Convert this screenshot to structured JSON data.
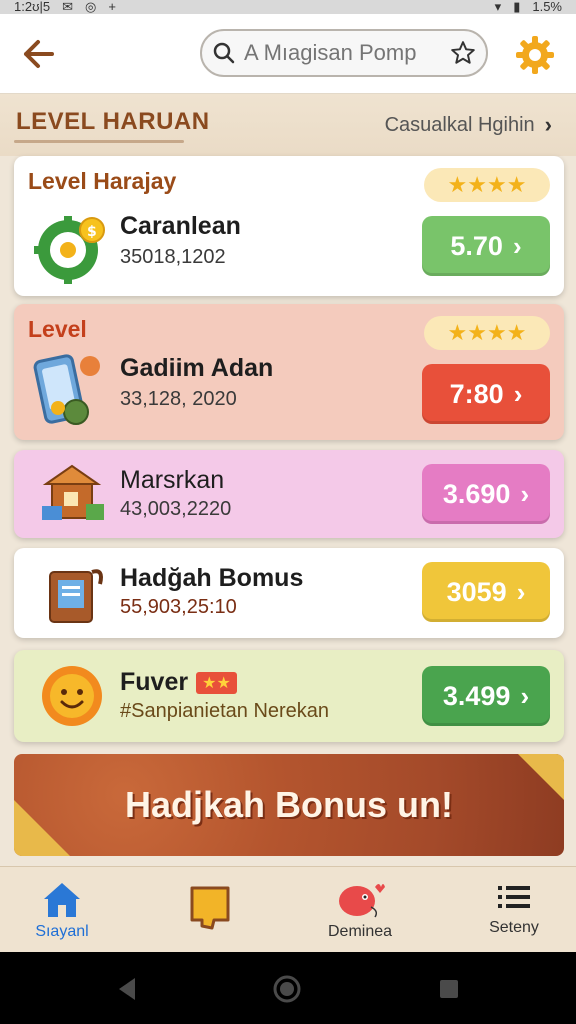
{
  "status_bar": {
    "time": "1:2ʊ|5",
    "battery": "1.5%"
  },
  "header": {
    "search_placeholder": "A Mıagisan Pomp"
  },
  "section": {
    "title": "LEVEL HARUAN",
    "link_label": "Casualkal Hgihin"
  },
  "cards": [
    {
      "tag": "Level Harajay",
      "name": "Caranlean",
      "meta": "35018,1202",
      "stars": "★★★★",
      "price": "5.70",
      "icon": "gear-coin-icon",
      "bg": "#ffffff",
      "tag_color": "#9a4b18",
      "btn_color": "#79c46a"
    },
    {
      "tag": "Level",
      "name": "Gadiim Adan",
      "meta": "33,128, 2020",
      "stars": "★★★★",
      "price": "7:80",
      "icon": "phone-gift-icon",
      "bg": "#f4cbbd",
      "tag_color": "#c4401c",
      "btn_color": "#e8503a"
    },
    {
      "name": "Marsrkan",
      "meta": "43,003,2220",
      "price": "3.690",
      "icon": "shop-icon",
      "bg": "#f4c9e8",
      "btn_color": "#e57cc4"
    },
    {
      "name": "Hadğah Bomus",
      "meta": "55,903,25:10",
      "price": "3059",
      "icon": "book-icon",
      "bg": "#ffffff",
      "btn_color": "#f0c63a"
    },
    {
      "name": "Fuver",
      "badge": "★★",
      "meta": "#Sanpianietan Nerekan",
      "price": "3.499",
      "icon": "sun-icon",
      "bg": "#e8eec4",
      "btn_color": "#4aa44e"
    }
  ],
  "banner": {
    "text": "Hadjkah Bonus un!"
  },
  "bottom_nav": [
    {
      "label": "Sıayanl",
      "icon": "home-icon"
    },
    {
      "label": "",
      "icon": "map-icon"
    },
    {
      "label": "Deminea",
      "icon": "pet-icon"
    },
    {
      "label": "Seteny",
      "icon": "menu-icon"
    }
  ]
}
